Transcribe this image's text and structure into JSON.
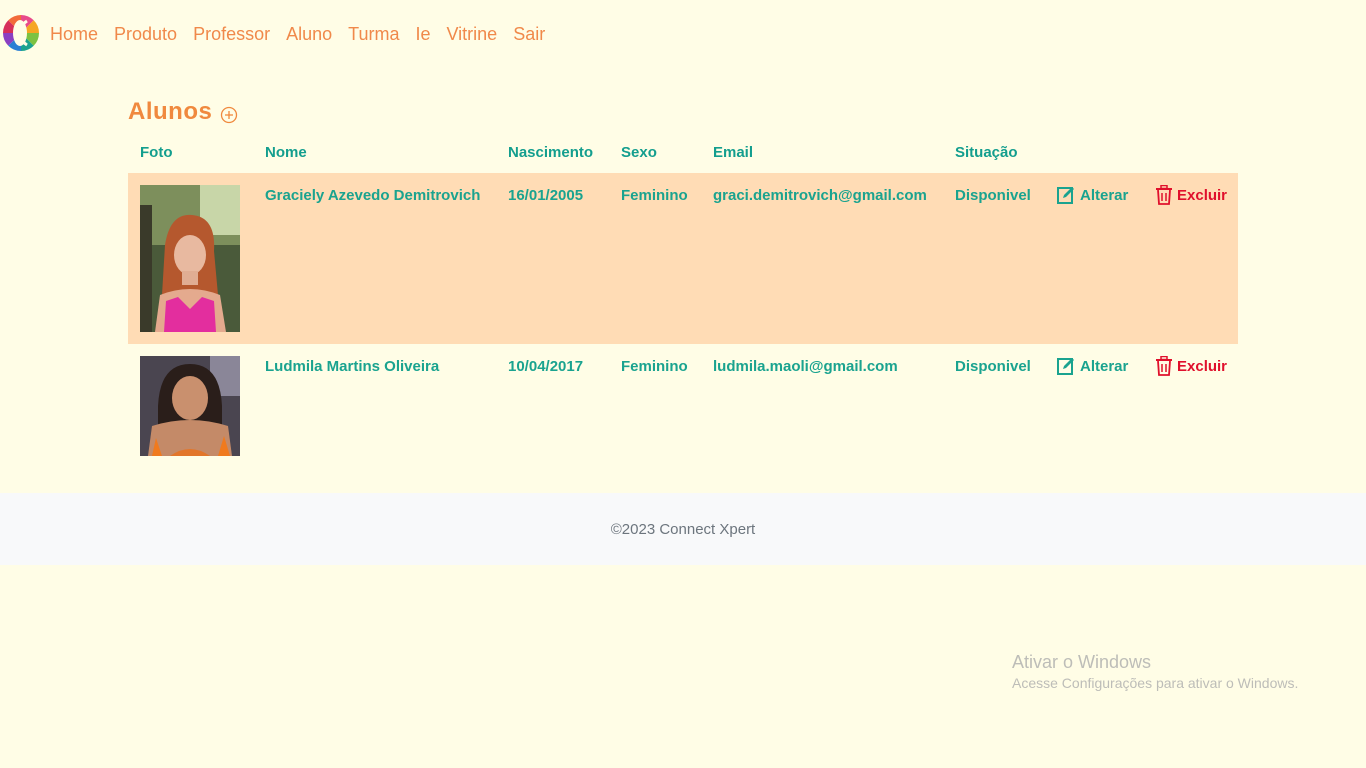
{
  "nav": {
    "logo": "connect-xpert-logo",
    "links": [
      "Home",
      "Produto",
      "Professor",
      "Aluno",
      "Turma",
      "Ie",
      "Vitrine",
      "Sair"
    ]
  },
  "page": {
    "title": "Alunos",
    "add_icon": "plus-circle-icon"
  },
  "table": {
    "headers": [
      "Foto",
      "Nome",
      "Nascimento",
      "Sexo",
      "Email",
      "Situação"
    ],
    "rows": [
      {
        "nome": "Graciely Azevedo Demitrovich",
        "nascimento": "16/01/2005",
        "sexo": "Feminino",
        "email": "graci.demitrovich@gmail.com",
        "situacao": "Disponivel",
        "alterar": "Alterar",
        "excluir": "Excluir"
      },
      {
        "nome": "Ludmila Martins Oliveira",
        "nascimento": "10/04/2017",
        "sexo": "Feminino",
        "email": "ludmila.maoli@gmail.com",
        "situacao": "Disponivel",
        "alterar": "Alterar",
        "excluir": "Excluir"
      }
    ]
  },
  "footer": {
    "text": "©2023 Connect Xpert"
  },
  "watermark": {
    "title": "Ativar o Windows",
    "subtitle": "Acesse Configurações para ativar o Windows."
  },
  "colors": {
    "background": "#fffde6",
    "accent_orange": "#f0893e",
    "accent_teal": "#1aa38f",
    "danger": "#e0102c",
    "row_highlight": "#ffdcb5"
  }
}
